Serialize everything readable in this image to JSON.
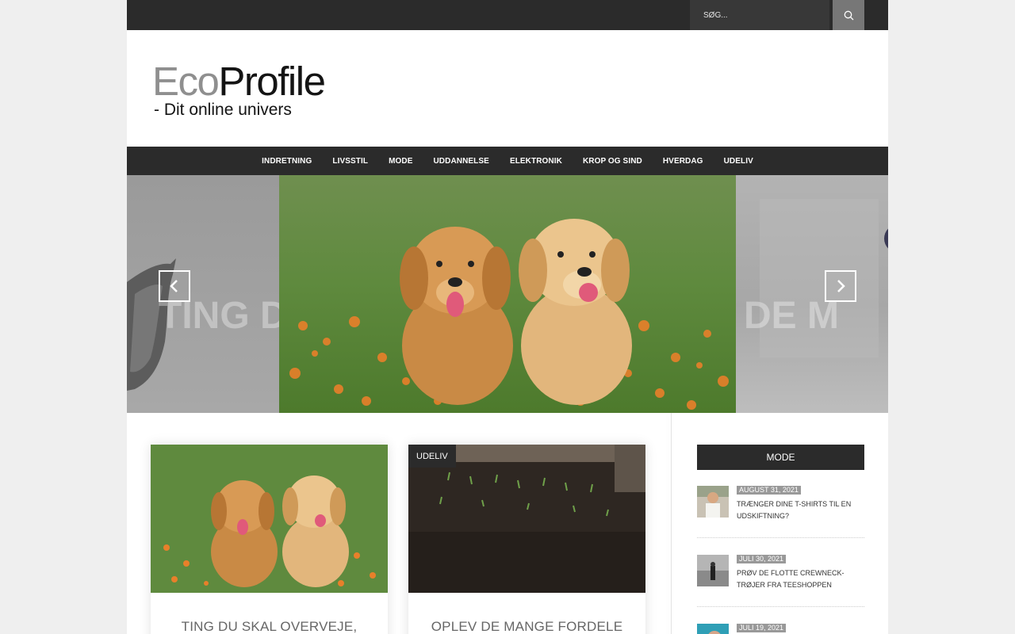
{
  "search": {
    "placeholder": "SØG..."
  },
  "logo": {
    "part1": "Eco",
    "part2": "Profile",
    "tagline": "- Dit online univers"
  },
  "nav": {
    "items": [
      "INDRETNING",
      "LIVSSTIL",
      "MODE",
      "UDDANNELSE",
      "ELEKTRONIK",
      "KROP OG SIND",
      "HVERDAG",
      "UDELIV"
    ]
  },
  "slider": {
    "ghost_left": "TING D",
    "ghost_right": "DE M"
  },
  "cards": [
    {
      "title": "TING DU SKAL OVERVEJE,",
      "badge": ""
    },
    {
      "title": "OPLEV DE MANGE FORDELE",
      "badge": "UDELIV"
    }
  ],
  "sidebar": {
    "widget_title": "MODE",
    "posts": [
      {
        "date": "AUGUST 31, 2021",
        "title": "TRÆNGER DINE T-SHIRTS TIL EN UDSKIFTNING?"
      },
      {
        "date": "JULI 30, 2021",
        "title": "PRØV DE FLOTTE CREWNECK-TRØJER FRA TEESHOPPEN"
      },
      {
        "date": "JULI 19, 2021",
        "title": ""
      }
    ]
  }
}
